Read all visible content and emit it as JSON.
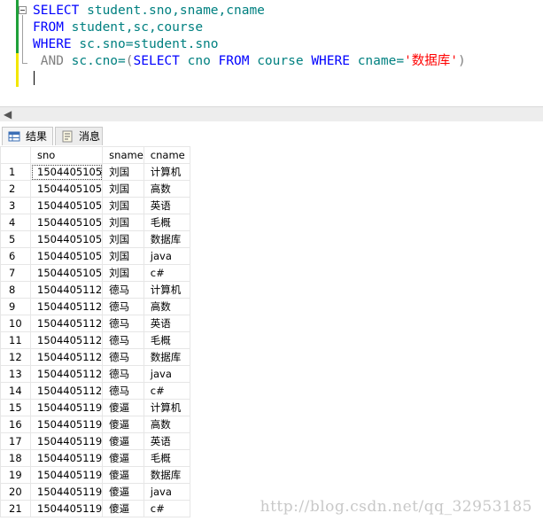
{
  "editor": {
    "lines": [
      [
        {
          "t": "SELECT",
          "c": "kw"
        },
        {
          "t": " student.sno,sname,cname",
          "c": "id"
        }
      ],
      [
        {
          "t": "FROM",
          "c": "kw"
        },
        {
          "t": " student,sc,course",
          "c": "id"
        }
      ],
      [
        {
          "t": "WHERE",
          "c": "kw"
        },
        {
          "t": " sc.sno=student.sno",
          "c": "id"
        }
      ],
      [
        {
          "t": " AND",
          "c": "gray"
        },
        {
          "t": " sc.cno=",
          "c": "id"
        },
        {
          "t": "(",
          "c": "gray"
        },
        {
          "t": "SELECT",
          "c": "kw"
        },
        {
          "t": " cno ",
          "c": "id"
        },
        {
          "t": "FROM",
          "c": "kw"
        },
        {
          "t": " course ",
          "c": "id"
        },
        {
          "t": "WHERE",
          "c": "kw"
        },
        {
          "t": " cname=",
          "c": "id"
        },
        {
          "t": "'数据库'",
          "c": "str"
        },
        {
          "t": ")",
          "c": "gray"
        }
      ]
    ]
  },
  "tabs": {
    "results": "结果",
    "messages": "消息"
  },
  "grid": {
    "columns": [
      "sno",
      "sname",
      "cname"
    ],
    "rows": [
      [
        "1504405105",
        "刘国",
        "计算机"
      ],
      [
        "1504405105",
        "刘国",
        "高数"
      ],
      [
        "1504405105",
        "刘国",
        "英语"
      ],
      [
        "1504405105",
        "刘国",
        "毛概"
      ],
      [
        "1504405105",
        "刘国",
        "数据库"
      ],
      [
        "1504405105",
        "刘国",
        "java"
      ],
      [
        "1504405105",
        "刘国",
        "c#"
      ],
      [
        "1504405112",
        "德马",
        "计算机"
      ],
      [
        "1504405112",
        "德马",
        "高数"
      ],
      [
        "1504405112",
        "德马",
        "英语"
      ],
      [
        "1504405112",
        "德马",
        "毛概"
      ],
      [
        "1504405112",
        "德马",
        "数据库"
      ],
      [
        "1504405112",
        "德马",
        "java"
      ],
      [
        "1504405112",
        "德马",
        "c#"
      ],
      [
        "1504405119",
        "傻逼",
        "计算机"
      ],
      [
        "1504405119",
        "傻逼",
        "高数"
      ],
      [
        "1504405119",
        "傻逼",
        "英语"
      ],
      [
        "1504405119",
        "傻逼",
        "毛概"
      ],
      [
        "1504405119",
        "傻逼",
        "数据库"
      ],
      [
        "1504405119",
        "傻逼",
        "java"
      ],
      [
        "1504405119",
        "傻逼",
        "c#"
      ]
    ]
  },
  "watermark": "http://blog.csdn.net/qq_32953185",
  "icons": {
    "scroll_left": "◀",
    "results_tab": "grid-icon",
    "messages_tab": "message-icon"
  }
}
